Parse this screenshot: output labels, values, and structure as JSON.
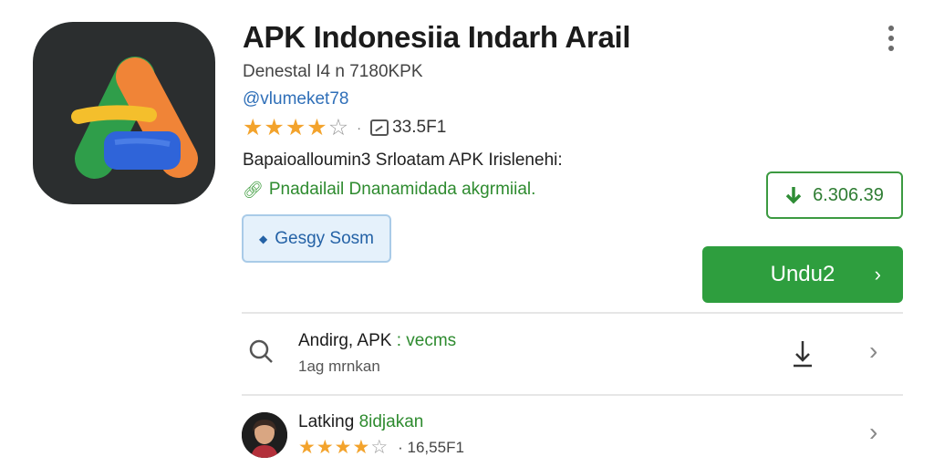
{
  "app": {
    "title": "APK Indonesiia Indarh Arail",
    "developer": "Denestal I4 n 7180KPK",
    "handle": "@vlumeket78",
    "rating": 4,
    "rating_max": 5,
    "size": "33.5F1",
    "description": "Bapaioalloumin3 Srloatam APK Irislenehi:",
    "note": "Pnadailail Dnanamidada akgrmiial.",
    "tag_button": "Gesgy Sosm",
    "download_count": "6.306.39",
    "install_button": "Undu2"
  },
  "list": {
    "row1": {
      "title": "Andirg, APK",
      "title_accent": ": vecms",
      "subtitle": "1ag mrnkan"
    },
    "row2": {
      "title": "Latking",
      "title_accent": "8idjakan",
      "rating": 4,
      "rating_max": 5,
      "size": "· 16,55F1"
    }
  },
  "icons": {
    "more": "more-vert-icon",
    "size": "image-size-icon",
    "note": "link-icon",
    "download": "download-arrow-icon",
    "search": "search-icon",
    "chevron": "chevron-right-icon"
  },
  "colors": {
    "accent_green": "#2e9e3e",
    "link_blue": "#2f6fb8",
    "star": "#f3a32c"
  }
}
